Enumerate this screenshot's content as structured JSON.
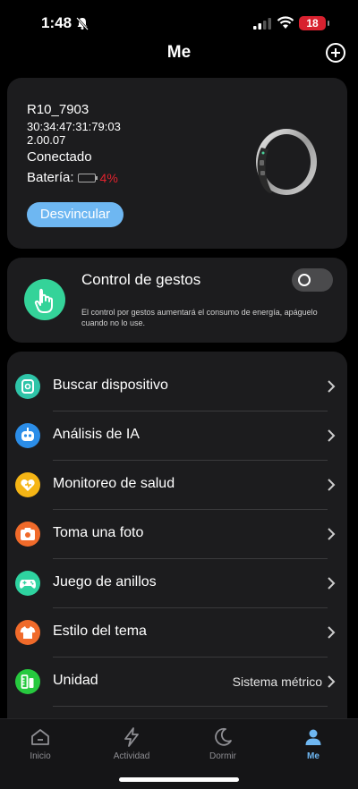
{
  "status_bar": {
    "time": "1:48",
    "battery": "18"
  },
  "header": {
    "title": "Me"
  },
  "device": {
    "name": "R10_7903",
    "mac": "30:34:47:31:79:03",
    "firmware": "2.00.07",
    "status": "Conectado",
    "battery_label": "Batería:",
    "battery_value": "4%",
    "unlink_label": "Desvincular"
  },
  "gesture": {
    "title": "Control de gestos",
    "description": "El control por gestos aumentará el consumo de energía, apáguelo cuando no lo use.",
    "enabled": false
  },
  "menu": {
    "items": [
      {
        "label": "Buscar dispositivo",
        "icon": "search-device-icon",
        "color": "#2ec4a8"
      },
      {
        "label": "Análisis de IA",
        "icon": "ai-robot-icon",
        "color": "#2b8de8"
      },
      {
        "label": "Monitoreo de salud",
        "icon": "heart-health-icon",
        "color": "#f5b515"
      },
      {
        "label": "Toma una foto",
        "icon": "camera-icon",
        "color": "#f06a2a"
      },
      {
        "label": "Juego de anillos",
        "icon": "gamepad-icon",
        "color": "#2ed3a0"
      },
      {
        "label": "Estilo del tema",
        "icon": "tshirt-icon",
        "color": "#f06a2a"
      },
      {
        "label": "Unidad",
        "value": "Sistema métrico",
        "icon": "unit-icon",
        "color": "#27c93f"
      }
    ]
  },
  "tabs": [
    {
      "label": "Inicio",
      "icon": "home-icon"
    },
    {
      "label": "Actividad",
      "icon": "lightning-icon"
    },
    {
      "label": "Dormir",
      "icon": "moon-icon"
    },
    {
      "label": "Me",
      "icon": "person-icon"
    }
  ],
  "colors": {
    "accent": "#6eb7f2",
    "alert": "#e0232e",
    "card": "#1c1c1e"
  }
}
